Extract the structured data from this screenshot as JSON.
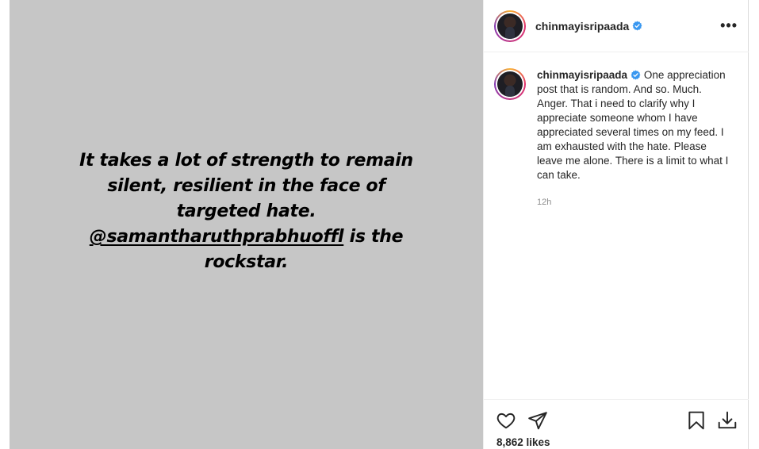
{
  "post": {
    "story_text_line1": "It takes a lot of strength to remain",
    "story_text_line2": "silent, resilient in the face of",
    "story_text_line3": "targeted hate.",
    "story_mention": "@samantharuthprabhuoffl",
    "story_text_line4_suffix": " is the",
    "story_text_line5": "rockstar."
  },
  "header": {
    "username": "chinmayisripaada",
    "more_label": "•••"
  },
  "caption": {
    "username": "chinmayisripaada",
    "text": " One appreciation post that is random. And so. Much. Anger. That i need to clarify why I appreciate someone whom I have appreciated several times on my feed. I am exhausted with the hate. Please leave me alone. There is a limit to what I can take.",
    "timestamp": "12h"
  },
  "actions": {
    "like_icon": "heart-icon",
    "share_icon": "send-icon",
    "save_icon": "bookmark-icon",
    "download_icon": "download-icon"
  },
  "likes": "8,862 likes",
  "colors": {
    "media_background": "#c6c6c6",
    "verified_blue": "#3897f0",
    "muted_text": "#8e8e8e"
  }
}
